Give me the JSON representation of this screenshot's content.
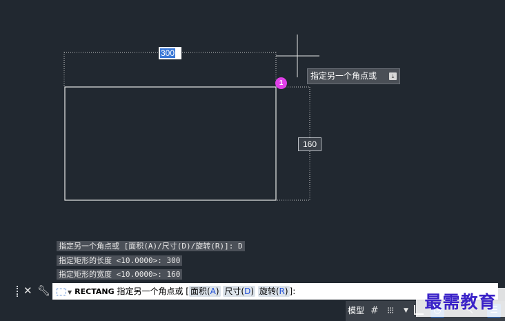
{
  "drawing": {
    "length_input": "300",
    "width_dim": "160",
    "point_marker": "1",
    "tooltip_text": "指定另一个角点或",
    "tooltip_icon": "download-arrow-icon"
  },
  "history": [
    "指定另一个角点或 [面积(A)/尺寸(D)/旋转(R)]: D",
    "指定矩形的长度 <10.0000>: 300",
    "指定矩形的宽度 <10.0000>: 160"
  ],
  "command": {
    "name": "RECTANG",
    "prompt": "指定另一个角点或 [",
    "options": [
      {
        "label": "面积(",
        "key": "A",
        "close": ")"
      },
      {
        "label": "尺寸(",
        "key": "D",
        "close": ")"
      },
      {
        "label": "旋转(",
        "key": "R",
        "close": ")"
      }
    ],
    "end": "]:",
    "icons": [
      "close-icon",
      "wrench-icon",
      "rectangle-command-icon"
    ]
  },
  "status": {
    "model_label": "模型",
    "icons": [
      "grid-icon",
      "snap-icon",
      "ortho-icon",
      "polar-icon",
      "lineweight-icon"
    ]
  },
  "watermark_text": "最需教育",
  "colors": {
    "canvas_bg": "#212830",
    "selection": "#3a78d6",
    "marker": "#e040e8",
    "option_key": "#1f4ed8",
    "watermark": "#3a22c8"
  }
}
